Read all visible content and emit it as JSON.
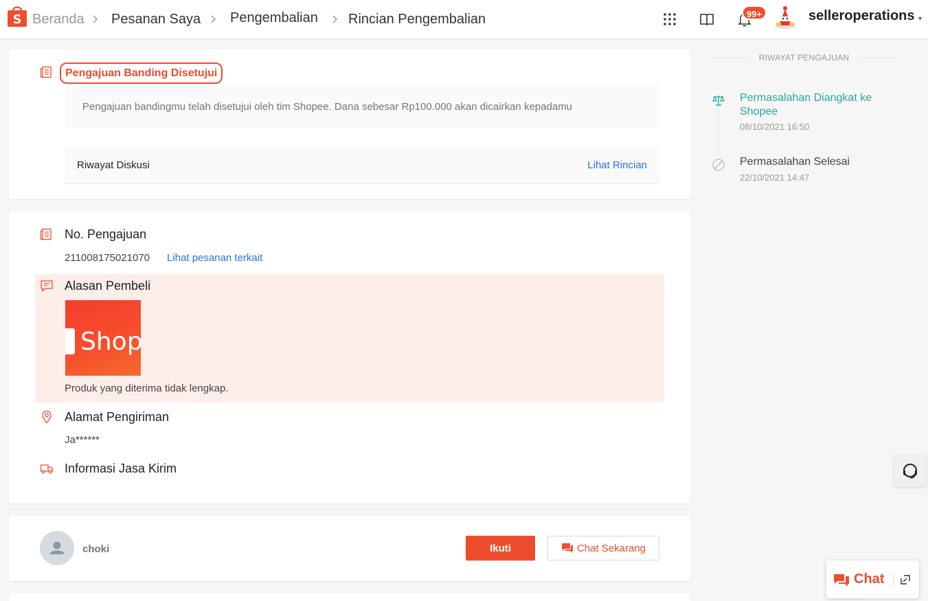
{
  "header": {
    "breadcrumbs": [
      "Beranda",
      "Pesanan Saya",
      "Pengembalian",
      "Rincian Pengembalian"
    ],
    "notification_count": "99+",
    "username": "selleroperations"
  },
  "status": {
    "title": "Pengajuan Banding Disetujui",
    "message": "Pengajuan bandingmu telah disetujui oleh tim Shopee. Dana sebesar Rp100.000 akan dicairkan kepadamu",
    "discussion_label": "Riwayat Diskusi",
    "discussion_link": "Lihat Rincian"
  },
  "details": {
    "request_no_label": "No. Pengajuan",
    "request_no": "211008175021070",
    "related_order_link": "Lihat pesanan terkait",
    "reason_label": "Alasan Pembeli",
    "reason_image_text": "Shopee",
    "reason_text": "Produk yang diterima tidak lengkap.",
    "address_label": "Alamat Pengiriman",
    "address_value": "Ja******",
    "shipping_label": "Informasi Jasa Kirim"
  },
  "follower": {
    "name": "choki",
    "follow_label": "Ikuti",
    "chat_label": "Chat Sekarang"
  },
  "timeline": {
    "heading": "RIWAYAT PENGAJUAN",
    "events": [
      {
        "title": "Permasalahan Diangkat ke Shopee",
        "time": "08/10/2021 16:50"
      },
      {
        "title": "Permasalahan Selesai",
        "time": "22/10/2021 14:47"
      }
    ]
  },
  "chat_widget": {
    "label": "Chat"
  },
  "colors": {
    "brand": "#ee4d2d",
    "link": "#2673dd",
    "success": "#26aa99"
  }
}
